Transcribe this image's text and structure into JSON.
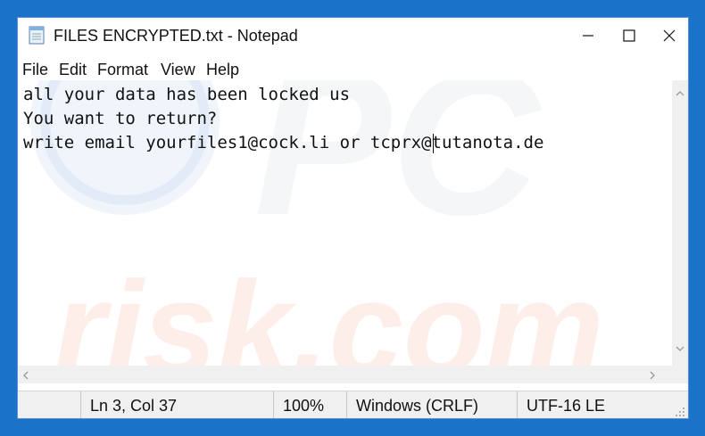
{
  "window": {
    "title": "FILES ENCRYPTED.txt - Notepad",
    "icon": "notepad-icon",
    "controls": [
      "minimize-icon",
      "maximize-icon",
      "close-icon"
    ]
  },
  "menu": [
    "File",
    "Edit",
    "Format",
    "View",
    "Help"
  ],
  "editor": {
    "lines": [
      "all your data has been locked us",
      "You want to return?",
      "write email yourfiles1@cock.li or tcprx@tutanota.de"
    ],
    "caret": {
      "line": 3,
      "column": 37
    }
  },
  "watermark": {
    "text": "risk.com",
    "logo_letters": "PC"
  },
  "statusbar": {
    "position": "Ln 3, Col 37",
    "zoom": "100%",
    "line_ending": "Windows (CRLF)",
    "encoding": "UTF-16 LE"
  },
  "colors": {
    "desktop": "#1a73c8",
    "window_border": "#5a8fd6",
    "watermark": "#e85a2a"
  }
}
